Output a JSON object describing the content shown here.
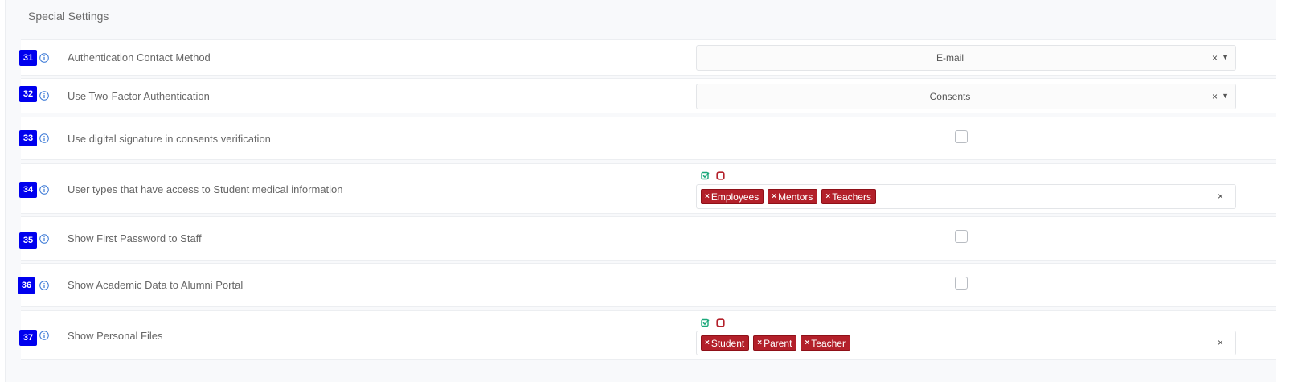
{
  "section": {
    "title": "Special Settings"
  },
  "rows": [
    {
      "num": "31",
      "label": "Authentication Contact Method",
      "select_value": "E-mail",
      "clear": "×",
      "arrow": "▼"
    },
    {
      "num": "32",
      "label": "Use Two-Factor Authentication",
      "select_value": "Consents",
      "clear": "×",
      "arrow": "▼"
    },
    {
      "num": "33",
      "label": "Use digital signature in consents verification",
      "checked": false
    },
    {
      "num": "34",
      "label": "User types that have access to Student medical information",
      "tags": [
        "Employees",
        "Mentors",
        "Teachers"
      ],
      "tag_remove": "×",
      "clear": "×"
    },
    {
      "num": "35",
      "label": "Show First Password to Staff",
      "checked": false
    },
    {
      "num": "36",
      "label": "Show Academic Data to Alumni Portal",
      "checked": false
    },
    {
      "num": "37",
      "label": "Show Personal Files",
      "tags": [
        "Student",
        "Parent",
        "Teacher"
      ],
      "tag_remove": "×",
      "clear": "×"
    }
  ],
  "colors": {
    "badge": "#0000ee",
    "tag": "#b3202a",
    "select_all_icon": "#1aa87a",
    "deselect_icon": "#b3202a"
  },
  "icons": {
    "info": "info-circle-icon",
    "select_all": "check-square-icon",
    "deselect": "square-icon"
  }
}
